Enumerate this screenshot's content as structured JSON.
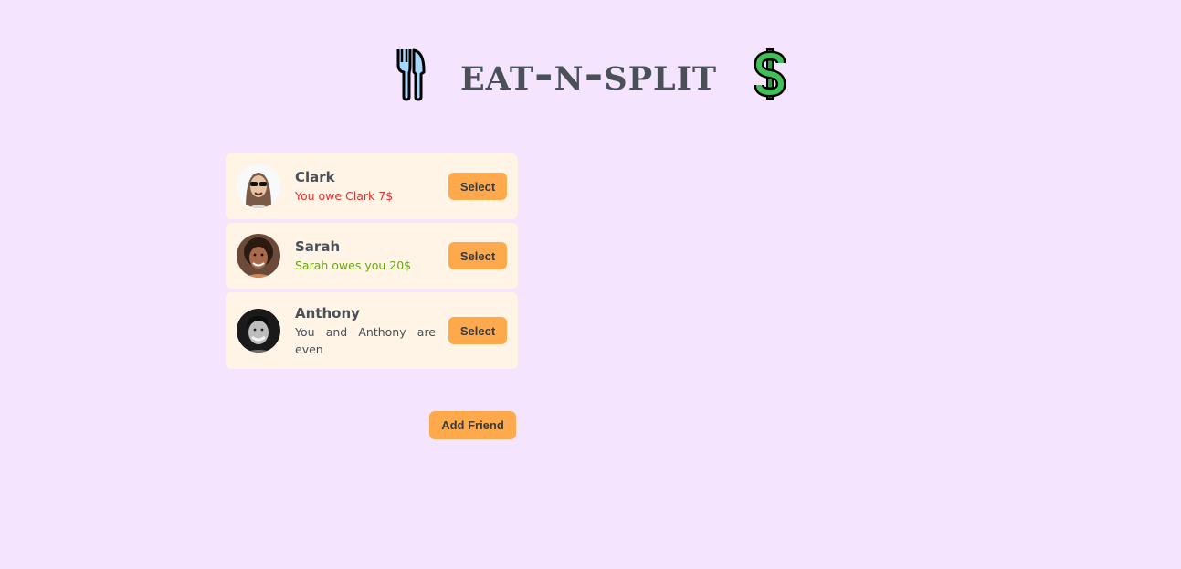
{
  "app": {
    "title": "eat-n-split",
    "icons": [
      "fork-knife-icon",
      "dollar-sign-icon"
    ],
    "colors": {
      "background": "#f4e4fe",
      "card": "#fff4e6",
      "button": "#ffa94d",
      "owe_red": "#e03131",
      "owed_green": "#66a80f",
      "text": "#495057"
    }
  },
  "friends": [
    {
      "name": "Clark",
      "balance_text": "You owe Clark 7$",
      "status": "negative",
      "avatar": "avatar-clark",
      "select_label": "Select"
    },
    {
      "name": "Sarah",
      "balance_text": "Sarah owes you 20$",
      "status": "positive",
      "avatar": "avatar-sarah",
      "select_label": "Select"
    },
    {
      "name": "Anthony",
      "balance_text": "You and Anthony are even",
      "status": "even",
      "avatar": "avatar-anthony",
      "select_label": "Select"
    }
  ],
  "add_friend_label": "Add Friend"
}
